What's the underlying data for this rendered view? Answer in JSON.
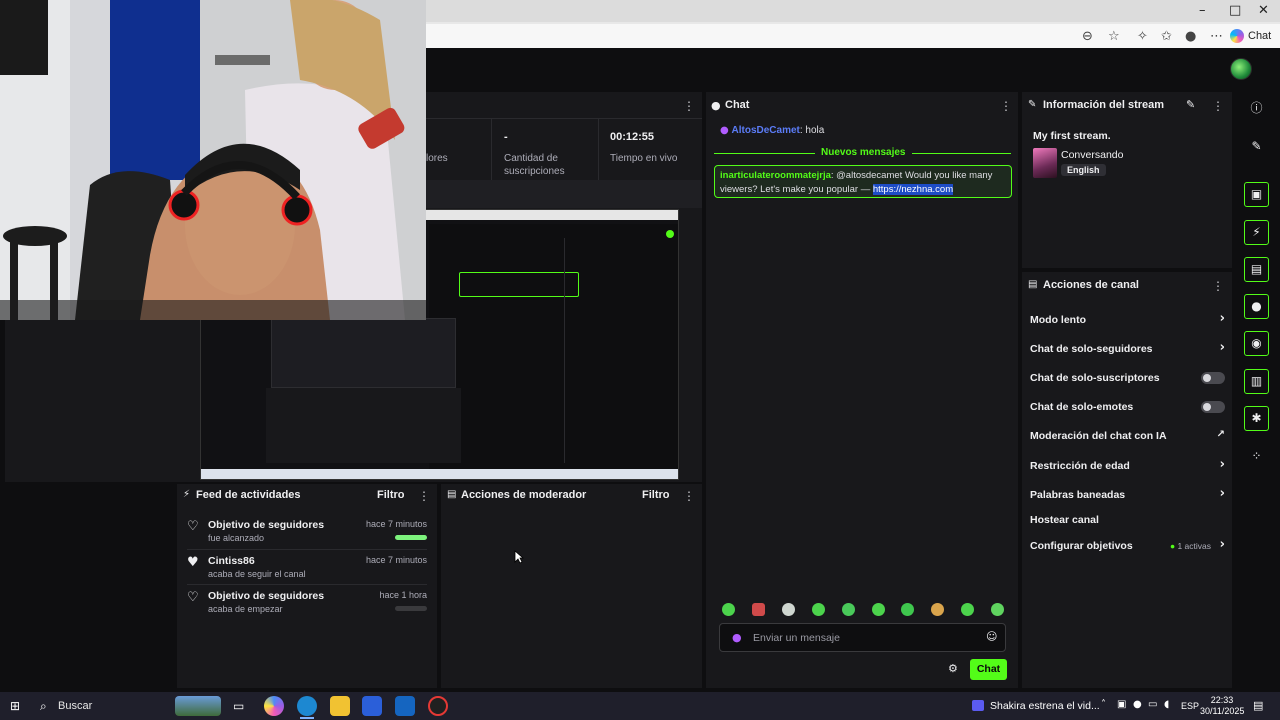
{
  "browser": {
    "copilot_label": "Chat",
    "controls": {
      "minimize": "–",
      "maximize": "□",
      "close": "✕"
    }
  },
  "stats": {
    "col1_value": "",
    "col1_label": "lores",
    "col2_value": "-",
    "col2_label_line1": "Cantidad de",
    "col2_label_line2": "suscripciones",
    "col3_value": "00:12:55",
    "col3_label": "Tiempo en vivo"
  },
  "feed": {
    "title": "Feed de actividades",
    "filter_label": "Filtro",
    "items": [
      {
        "title": "Objetivo de seguidores",
        "subtitle": "fue alcanzado",
        "time": "hace 7 minutos",
        "progress": 1.0
      },
      {
        "title": "Cintiss86",
        "subtitle": "acaba de seguir el canal",
        "time": "hace 7 minutos"
      },
      {
        "title": "Objetivo de seguidores",
        "subtitle": "acaba de empezar",
        "time": "hace 1 hora",
        "progress": 0.0
      }
    ]
  },
  "moderator": {
    "title": "Acciones de moderador",
    "filter_label": "Filtro"
  },
  "chat": {
    "title": "Chat",
    "messages": [
      {
        "user": "AltosDeCamet",
        "text": ": hola",
        "user_color": "#5b7cf7"
      }
    ],
    "new_messages_label": "Nuevos mensajes",
    "highlight": {
      "user": "inarticulateroommatejrja",
      "text": ": @altosdecamet Would you like many viewers? Let's make you popular — ",
      "link": "https://nezhna.com"
    },
    "input_placeholder": "Enviar un mensaje",
    "send_label": "Chat"
  },
  "stream_info": {
    "title": "Información del stream",
    "stream_title": "My first stream.",
    "category": "Conversando",
    "language": "English"
  },
  "channel_actions": {
    "title": "Acciones de canal",
    "items": [
      {
        "label": "Modo lento",
        "control": "chevron"
      },
      {
        "label": "Chat de solo-seguidores",
        "control": "chevron"
      },
      {
        "label": "Chat de solo-suscriptores",
        "control": "toggle",
        "on": false
      },
      {
        "label": "Chat de solo-emotes",
        "control": "toggle",
        "on": false
      },
      {
        "label": "Moderación del chat con IA",
        "control": "external"
      },
      {
        "label": "Restricción de edad",
        "control": "chevron"
      },
      {
        "label": "Palabras baneadas",
        "control": "chevron"
      },
      {
        "label": "Hostear canal",
        "control": "none"
      },
      {
        "label": "Configurar objetivos",
        "control": "chevron",
        "note": "1 activas"
      }
    ]
  },
  "taskbar": {
    "search_label": "Buscar",
    "news_text": "Shakira estrena el vid...",
    "language": "ESP",
    "time": "22:33",
    "date": "30/11/2025"
  },
  "colors": {
    "accent": "#53fc18",
    "panel": "#18181b",
    "background": "#0e0e10"
  }
}
